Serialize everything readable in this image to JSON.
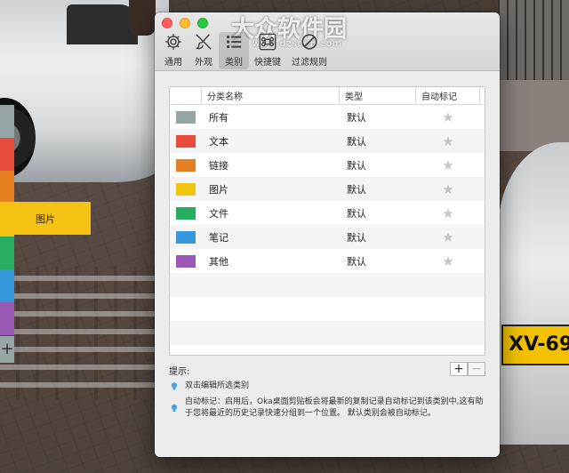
{
  "app": {
    "watermark_logo": "大众软件园",
    "watermark_url": "www.dzsoon.com"
  },
  "tabs": [
    {
      "label": "通用",
      "icon": "gear-icon"
    },
    {
      "label": "外观",
      "icon": "brush-icon"
    },
    {
      "label": "类别",
      "icon": "list-icon",
      "active": true
    },
    {
      "label": "快捷键",
      "icon": "command-icon"
    },
    {
      "label": "过滤规则",
      "icon": "block-icon"
    }
  ],
  "table": {
    "headers": {
      "name": "分类名称",
      "type": "类型",
      "auto": "自动标记"
    },
    "rows": [
      {
        "color": "#95a5a6",
        "name": "所有",
        "type": "默认"
      },
      {
        "color": "#e74c3c",
        "name": "文本",
        "type": "默认"
      },
      {
        "color": "#e67e22",
        "name": "链接",
        "type": "默认"
      },
      {
        "color": "#f1c40f",
        "name": "图片",
        "type": "默认"
      },
      {
        "color": "#27ae60",
        "name": "文件",
        "type": "默认"
      },
      {
        "color": "#3498db",
        "name": "笔记",
        "type": "默认"
      },
      {
        "color": "#9b59b6",
        "name": "其他",
        "type": "默认"
      }
    ],
    "star_glyph": "★"
  },
  "controls": {
    "add": "+",
    "remove": "−"
  },
  "hints": {
    "label": "提示:",
    "hint1": "双击编辑所选类别",
    "hint2": "自动标记：启用后，Oka桌面剪贴板会将最新的复制记录自动标记到该类别中,这有助于您将最近的历史记录快速分组到一个位置。 默认类别会被自动标记。"
  },
  "side": {
    "rail_colors": [
      "#95a5a6",
      "#e74c3c",
      "#e67e22",
      "#f1c40f",
      "#27ae60",
      "#3498db",
      "#9b59b6"
    ],
    "floating_tab": "图片",
    "plus": "+",
    "plate": "XV-69"
  }
}
